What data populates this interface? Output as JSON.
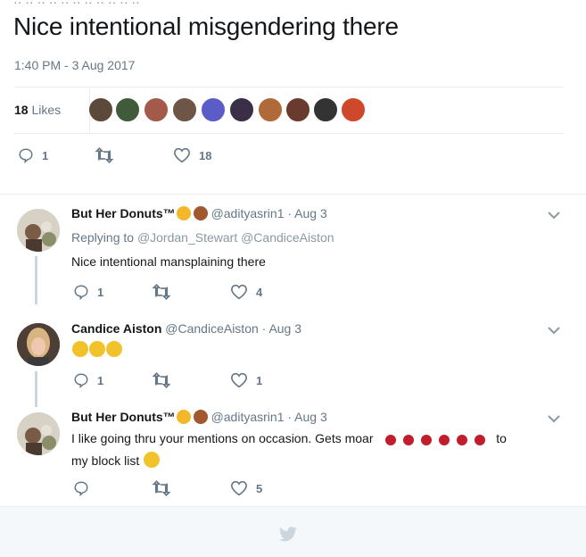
{
  "main_tweet": {
    "text": "Nice intentional misgendering there",
    "timestamp": "1:40 PM - 3 Aug 2017",
    "likes_count": "18",
    "likes_label": "Likes",
    "reply_count": "1",
    "retweet_count": "",
    "like_count": "18",
    "liker_avatar_colors": [
      "#5b4a3c",
      "#3f5b3a",
      "#a35a4b",
      "#6d5548",
      "#5c5cc9",
      "#3a2f47",
      "#b06a3a",
      "#6b3a2f",
      "#333333",
      "#d0482c"
    ]
  },
  "replies": [
    {
      "display_name": "But Her Donuts™",
      "handle_time": "@adityasrin1 · Aug 3",
      "replying_label": "Replying to",
      "replying_mentions": "@Jordan_Stewart @CandiceAiston",
      "text": "Nice intentional mansplaining there",
      "reply_count": "1",
      "like_count": "4"
    },
    {
      "display_name": "Candice Aiston",
      "handle_time": "@CandiceAiston · Aug 3",
      "reply_count": "1",
      "like_count": "1"
    },
    {
      "display_name": "But Her Donuts™",
      "handle_time": "@adityasrin1 · Aug 3",
      "text_line1": "I like going thru your mentions on occasion. Gets moar",
      "text_after_roses": "to",
      "text_line2": "my block list",
      "reply_count": "",
      "like_count": "5"
    }
  ],
  "colors": {
    "text": "#14171a",
    "secondary": "#657786",
    "divider": "#e6ecf0",
    "footer_bg": "#f5f8fa"
  }
}
